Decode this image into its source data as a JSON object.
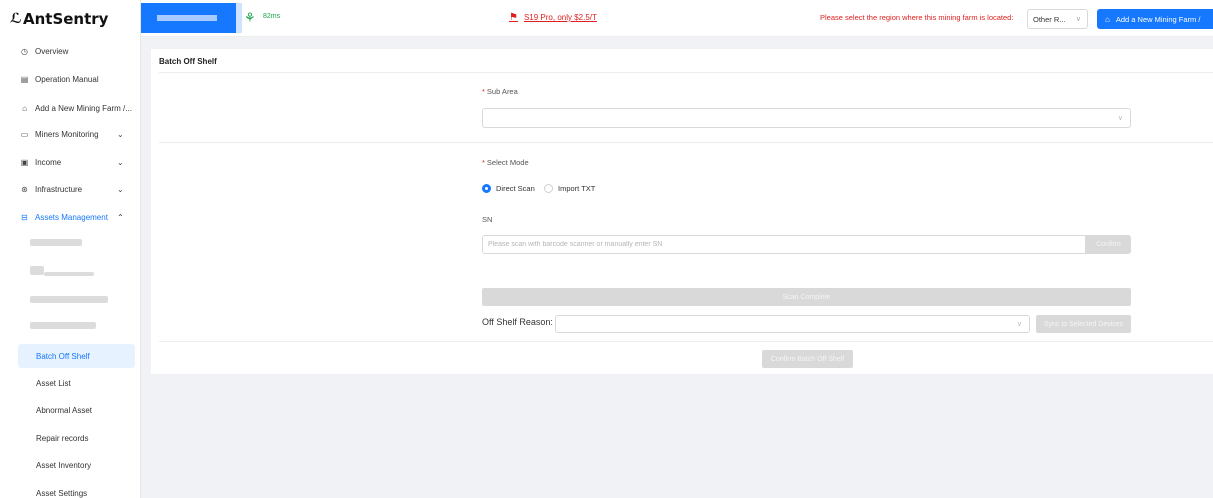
{
  "app": {
    "logo_text": "AntSentry"
  },
  "header": {
    "latency": "82ms",
    "promo": "S19 Pro, only $2.5/T",
    "region_prompt": "Please select the region where this mining farm is located:",
    "region_value": "Other R...",
    "add_farm_label": "Add a New Mining Farm /"
  },
  "sidebar": {
    "items": [
      {
        "label": "Overview",
        "icon": "clock-icon"
      },
      {
        "label": "Operation Manual",
        "icon": "book-icon"
      },
      {
        "label": "Add a New Mining Farm /...",
        "icon": "bank-icon"
      },
      {
        "label": "Miners Monitoring",
        "icon": "monitor-icon"
      },
      {
        "label": "Income",
        "icon": "wallet-icon"
      },
      {
        "label": "Infrastructure",
        "icon": "settings-icon"
      },
      {
        "label": "Assets Management",
        "icon": "box-icon"
      }
    ],
    "sub_items": [
      {
        "label": "Batch Off Shelf"
      },
      {
        "label": "Asset List"
      },
      {
        "label": "Abnormal Asset"
      },
      {
        "label": "Repair records"
      },
      {
        "label": "Asset Inventory"
      },
      {
        "label": "Asset Settings"
      }
    ]
  },
  "main": {
    "title": "Batch Off Shelf",
    "sub_area_label": "Sub Area",
    "select_mode_label": "Select Mode",
    "mode_options": [
      "Direct Scan",
      "Import TXT"
    ],
    "mode_selected": "Direct Scan",
    "sn_label": "SN",
    "sn_placeholder": "Please scan with barcode scanner or manually enter SN",
    "confirm_label": "Confirm",
    "scan_complete_label": "Scan Complete",
    "off_shelf_reason_label": "Off Shelf Reason:",
    "sync_label": "Sync to Selected Devices",
    "confirm_batch_label": "Confirm Batch Off Shelf"
  },
  "colors": {
    "accent": "#1677ff",
    "alert": "#e02020",
    "ok": "#17a34a"
  }
}
